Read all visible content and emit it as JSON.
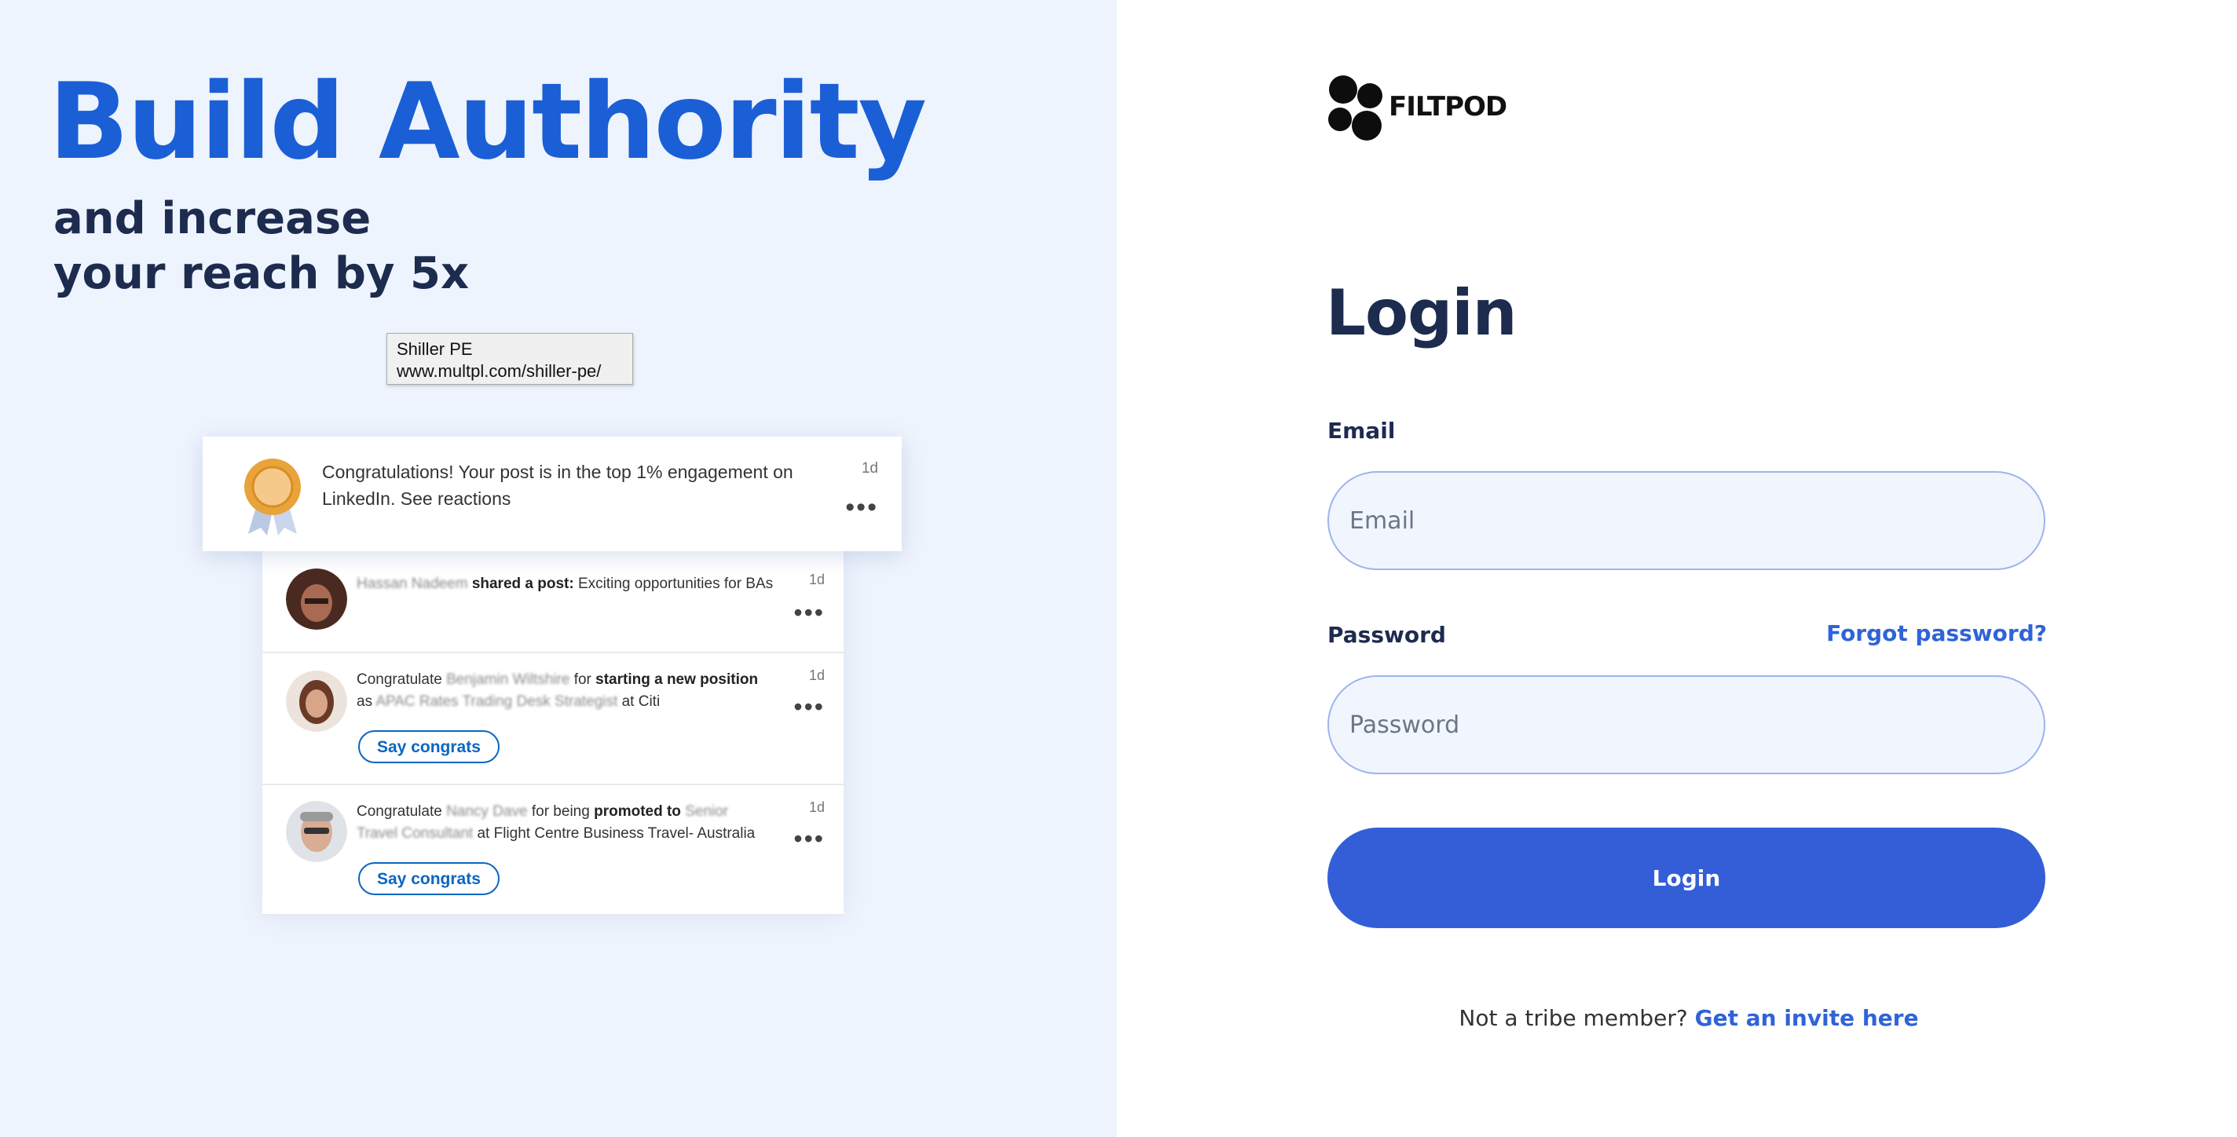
{
  "hero": {
    "title": "Build Authority",
    "subtitle_line1": "and increase",
    "subtitle_line2": "your reach by 5x"
  },
  "tooltip": {
    "line1": "Shiller PE",
    "line2": "www.multpl.com/shiller-pe/"
  },
  "notification": {
    "text": "Congratulations! Your post is in the top 1% engagement on LinkedIn. See reactions",
    "time": "1d",
    "more_icon": "ellipsis-icon"
  },
  "feed": [
    {
      "name": "Hassan Nadeem",
      "prefix": "",
      "action": "shared a post:",
      "detail": "Exciting opportunities for BAs",
      "time": "1d"
    },
    {
      "prefix": "Congratulate",
      "name": "Benjamin Wiltshire",
      "action_pre": "for",
      "action": "starting a new position",
      "line2_pre": "as",
      "role": "APAC Rates Trading Desk Strategist",
      "company": "at Citi",
      "time": "1d",
      "button": "Say congrats"
    },
    {
      "prefix": "Congratulate",
      "name": "Nancy Dave",
      "action_pre": "for being",
      "action": "promoted to",
      "role_line1": "Senior",
      "role": "Travel Consultant",
      "company": "at Flight Centre Business Travel- Australia",
      "time": "1d",
      "button": "Say congrats"
    }
  ],
  "brand": {
    "name": "FILTPOD"
  },
  "login": {
    "title": "Login",
    "email_label": "Email",
    "email_placeholder": "Email",
    "email_value": "",
    "password_label": "Password",
    "password_placeholder": "Password",
    "password_value": "",
    "forgot_link": "Forgot password?",
    "submit_label": "Login",
    "invite_text": "Not a tribe member?",
    "invite_link": "Get an invite here"
  },
  "colors": {
    "accent": "#335ed8",
    "hero_blue": "#1a5fd6",
    "navy": "#1d2b4f",
    "left_bg": "#eef4fd",
    "linkedin_blue": "#0a66c2"
  }
}
